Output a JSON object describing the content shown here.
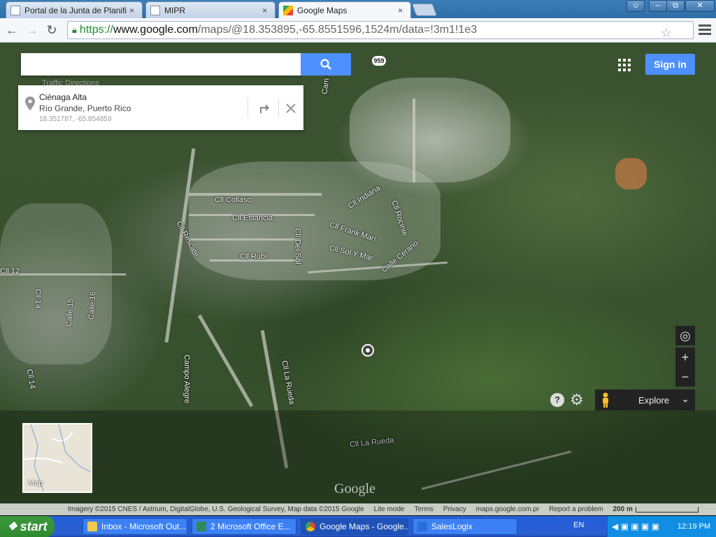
{
  "browser": {
    "tabs": [
      {
        "title": "Portal de la Junta de Planificac"
      },
      {
        "title": "MIPR"
      },
      {
        "title": "Google Maps"
      }
    ],
    "url": {
      "scheme": "https://",
      "host": "www.google.com",
      "path": "/maps/@18.353895,-65.8551596,1524m/data=!3m1!1e3"
    },
    "close_glyph": "×"
  },
  "maps": {
    "search_placeholder": "",
    "traffic_label": "Traffic Directions",
    "sign_in": "Sign in",
    "explore": "Explore",
    "card": {
      "name": "Ciénaga Alta",
      "region": "Río Grande, Puerto Rico",
      "coords": "18.351787, -65.854859"
    },
    "route_badge": "959",
    "minimap_label": "Map",
    "logo": "Google",
    "streets": [
      "Cll Collaso",
      "Cll Estancia",
      "Cll Del Sol",
      "Cll Rubí",
      "Cll Rescate",
      "Cll Indiana",
      "Cll Frank Marí",
      "Cll Rocinie",
      "Cll Sol Y Mar",
      "Calle Cerario",
      "Cll 12",
      "Cll 14",
      "Calle 15",
      "Calle 16",
      "Cll 14",
      "Campo Alegre",
      "Cll La Rueda",
      "Cll La Rueda",
      "Cam Lopez"
    ],
    "footer": {
      "imagery": "Imagery ©2015 CNES / Astrium, DigitalGlobe, U.S. Geological Survey, Map data ©2015 Google",
      "lite": "Lite mode",
      "terms": "Terms",
      "privacy": "Privacy",
      "domain": "maps.google.com.pr",
      "report": "Report a problem",
      "scale": "200 m"
    }
  },
  "taskbar": {
    "start": "start",
    "items": [
      {
        "label": "Inbox - Microsoft Out..."
      },
      {
        "label": "2 Microsoft Office E..."
      },
      {
        "label": "Google Maps - Google..."
      },
      {
        "label": "SalesLogix"
      }
    ],
    "lang": "EN",
    "time": "12:19 PM"
  }
}
